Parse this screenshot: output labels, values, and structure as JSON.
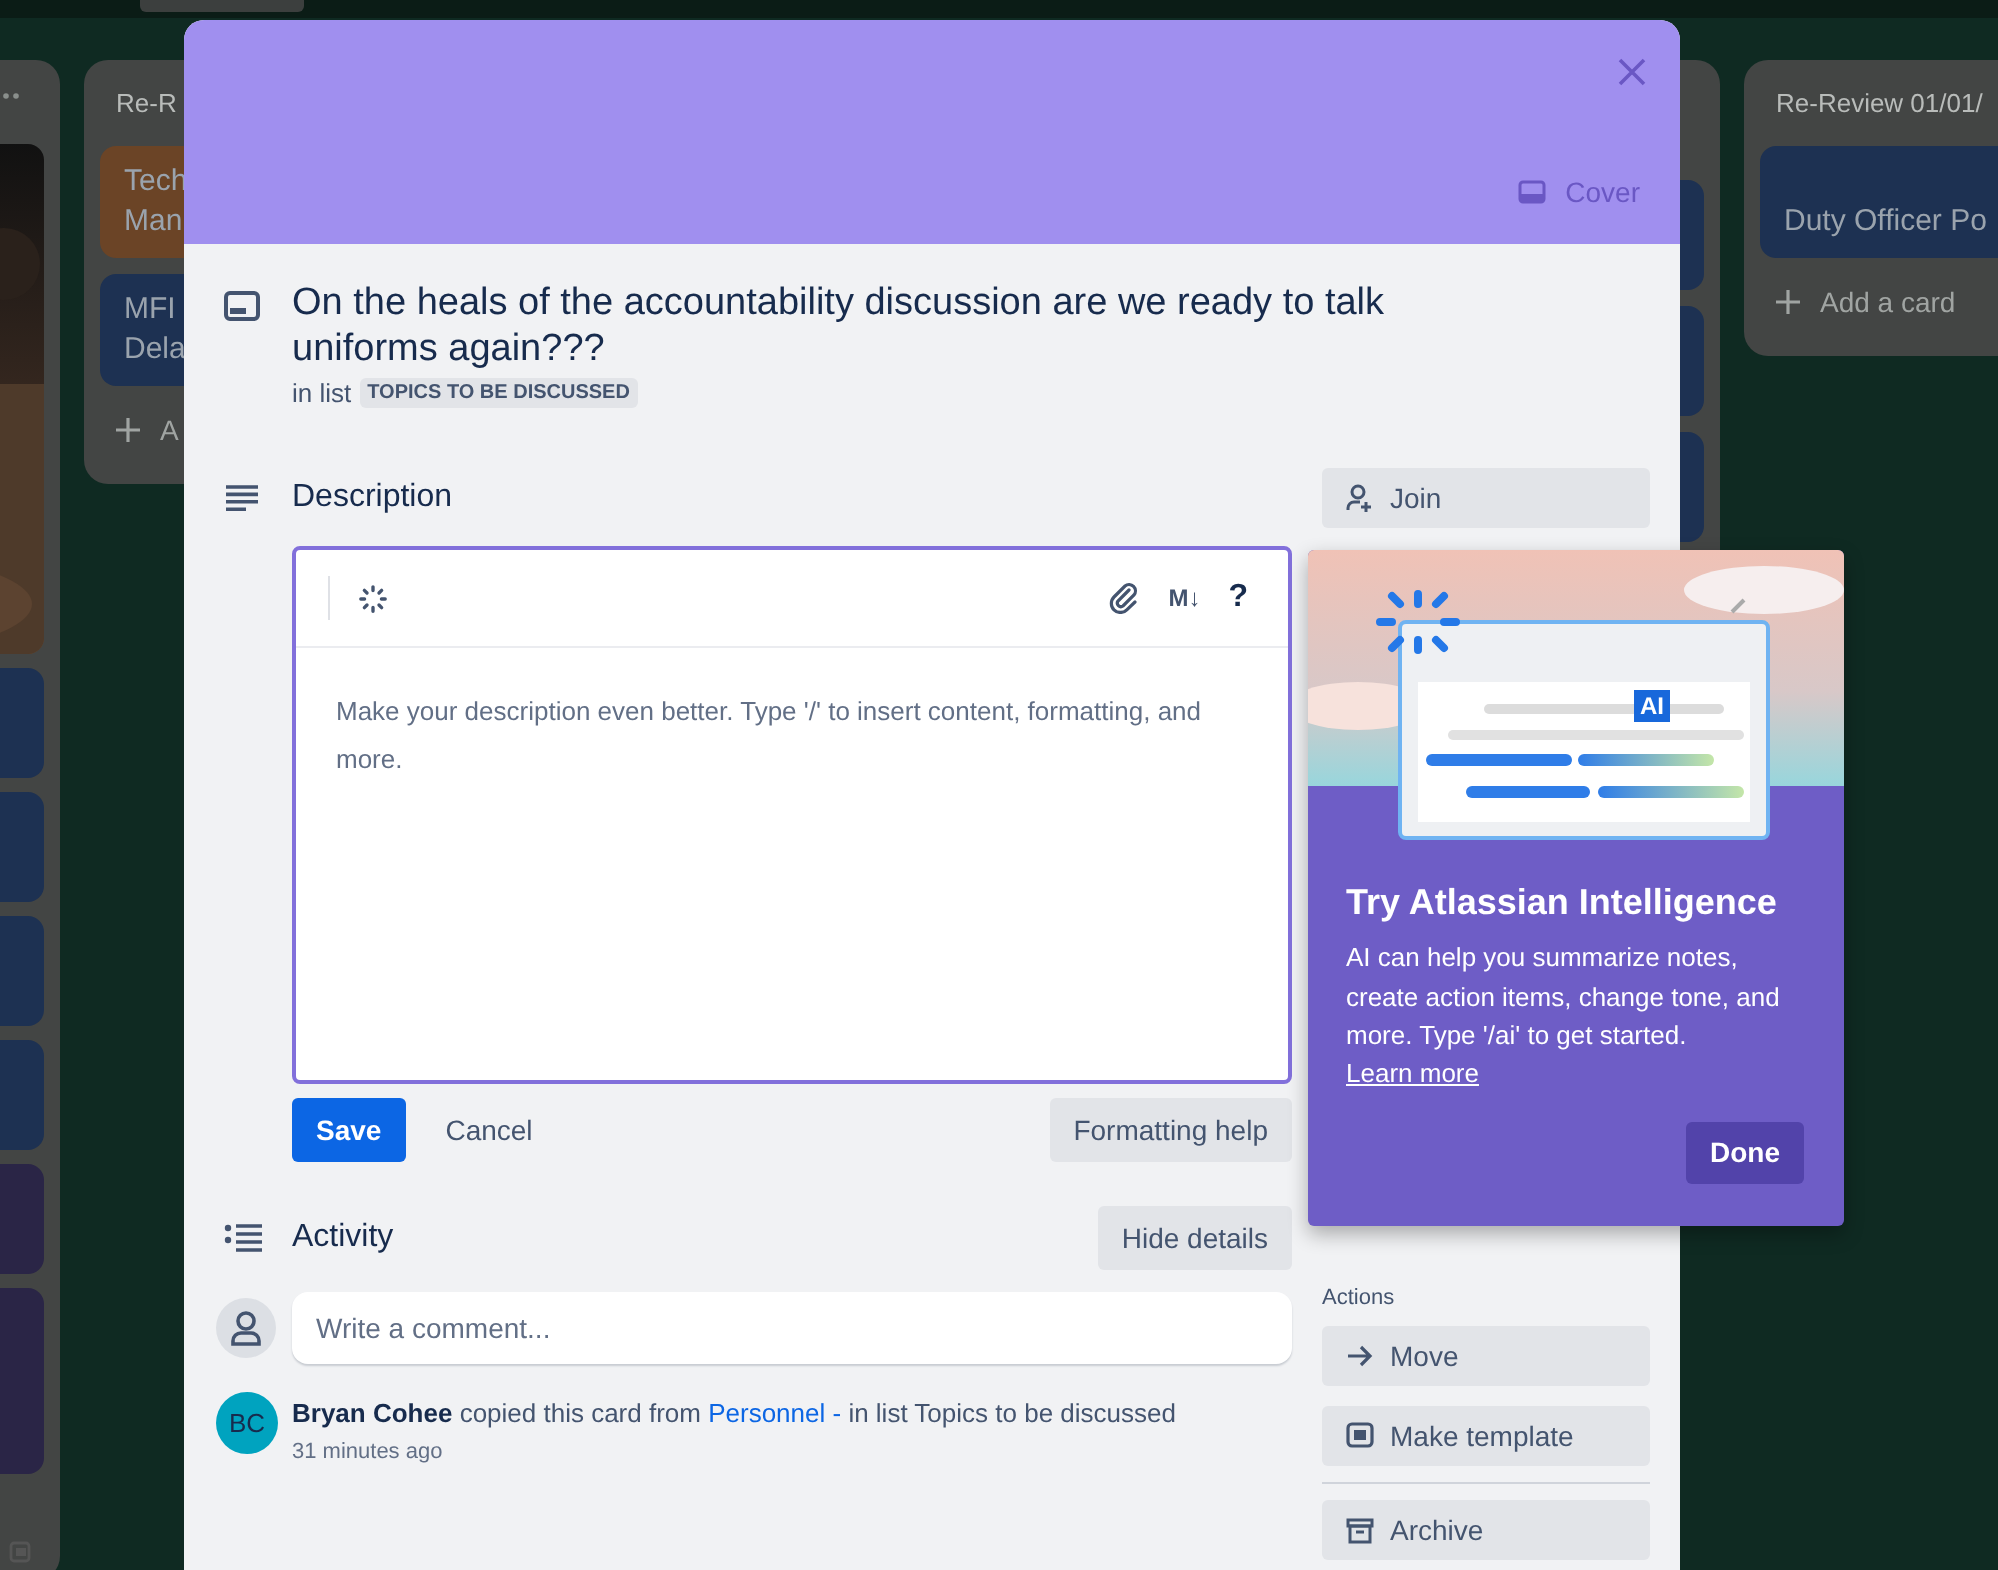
{
  "board": {
    "lists": [
      {
        "kind": "edge",
        "cards": [
          {
            "kind": "picture"
          },
          {
            "kind": "plain",
            "color": "#1d3152"
          },
          {
            "kind": "plain",
            "color": "#1d3152"
          },
          {
            "kind": "plain",
            "color": "#1d3152"
          },
          {
            "kind": "plain",
            "color": "#1d3152"
          },
          {
            "kind": "plain",
            "color": "#2a2546"
          },
          {
            "kind": "plain",
            "color": "#2a2546"
          }
        ]
      },
      {
        "kind": "list",
        "title": "Re-R",
        "cards": [
          {
            "lines": [
              "Tech",
              "Man"
            ],
            "color": "#6b4426"
          },
          {
            "lines": [
              "MFI",
              "Dela"
            ],
            "color": "#1d3152"
          }
        ],
        "add_label": "A"
      },
      {
        "kind": "hidden",
        "cards": [
          {
            "color": "#1d3152"
          },
          {
            "color": "#1d3152"
          },
          {
            "color": "#1d3152"
          }
        ]
      },
      {
        "kind": "list",
        "title": "Re-Review 01/01/",
        "cards": [
          {
            "lines": [
              "Duty Officer Po"
            ],
            "color": "#1d3152"
          }
        ],
        "add_label": "Add a card"
      }
    ]
  },
  "card": {
    "cover_button": "Cover",
    "title_lines": [
      "On the heals of the accountability discussion are we ready to talk",
      "uniforms again???"
    ],
    "in_list_prefix": "in list",
    "list_name": "TOPICS TO BE DISCUSSED",
    "description": {
      "heading": "Description",
      "placeholder": "Make your description even better. Type '/' to insert content, formatting, and more.",
      "markdown_label": "M↓",
      "help_label": "?",
      "save": "Save",
      "cancel": "Cancel",
      "formatting_help": "Formatting help"
    },
    "activity": {
      "heading": "Activity",
      "hide_details": "Hide details",
      "comment_placeholder": "Write a comment...",
      "entries": [
        {
          "initials": "BC",
          "author": "Bryan Cohee",
          "action": "copied this card from",
          "link": "Personnel -",
          "rest": "in list Topics to be discussed",
          "time": "31 minutes ago"
        }
      ]
    },
    "sidebar": {
      "join": "Join",
      "actions_label": "Actions",
      "actions": [
        {
          "kind": "move",
          "label": "Move"
        },
        {
          "kind": "template",
          "label": "Make template"
        },
        {
          "kind": "archive",
          "label": "Archive"
        }
      ]
    }
  },
  "ai_popup": {
    "badge": "AI",
    "title": "Try Atlassian Intelligence",
    "body": "AI can help you summarize notes, create action items, change tone, and more. Type '/ai' to get started.",
    "link": "Learn more",
    "done": "Done"
  }
}
